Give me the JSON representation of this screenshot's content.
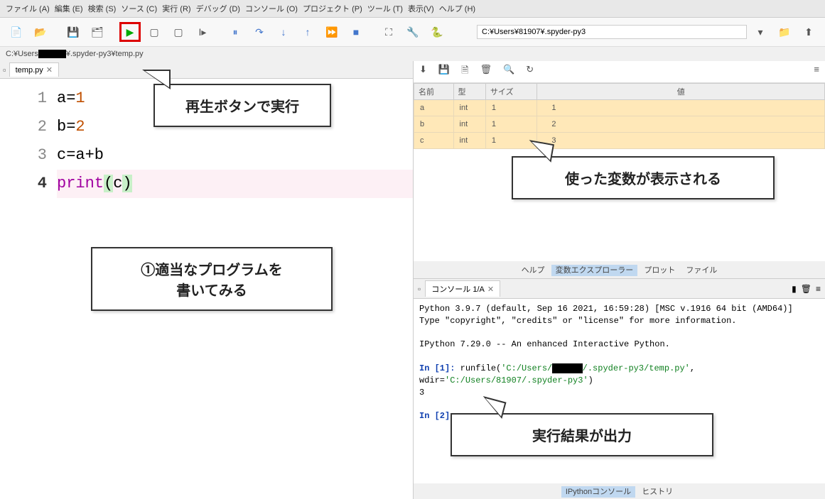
{
  "menubar": [
    "ファイル (A)",
    "編集 (E)",
    "検索 (S)",
    "ソース (C)",
    "実行 (R)",
    "デバッグ (D)",
    "コンソール (O)",
    "プロジェクト (P)",
    "ツール (T)",
    "表示(V)",
    "ヘルプ (H)"
  ],
  "path_value": "C:¥Users¥81907¥.spyder-py3",
  "breadcrumb_prefix": "C:¥Users",
  "breadcrumb_suffix": "¥.spyder-py3¥temp.py",
  "editor": {
    "tab_label": "temp.py",
    "lines": [
      {
        "n": "1",
        "plain": "a=",
        "num": "1"
      },
      {
        "n": "2",
        "plain": "b=",
        "num": "2"
      },
      {
        "n": "3",
        "plain": "c=a+b",
        "num": ""
      },
      {
        "n": "4",
        "func": "print",
        "open": "(",
        "arg": "c",
        "close": ")"
      }
    ]
  },
  "variables": {
    "headers": [
      "名前",
      "型",
      "サイズ",
      "値"
    ],
    "rows": [
      {
        "name": "a",
        "type": "int",
        "size": "1",
        "value": "1"
      },
      {
        "name": "b",
        "type": "int",
        "size": "1",
        "value": "2"
      },
      {
        "name": "c",
        "type": "int",
        "size": "1",
        "value": "3"
      }
    ]
  },
  "pane_tabs": [
    "ヘルプ",
    "変数エクスプローラー",
    "プロット",
    "ファイル"
  ],
  "console": {
    "tab_label": "コンソール 1/A",
    "banner1": "Python 3.9.7 (default, Sep 16 2021, 16:59:28) [MSC v.1916 64 bit (AMD64)]",
    "banner2": "Type \"copyright\", \"credits\" or \"license\" for more information.",
    "banner3": "IPython 7.29.0 -- An enhanced Interactive Python.",
    "in1_label": "In [1]:",
    "in1_cmd": " runfile(",
    "in1_path1": "'C:/Users/",
    "in1_path2": "/.spyder-py3/temp.py'",
    "in1_mid": ", wdir=",
    "in1_path3": "'C:/Users/81907/.spyder-py3'",
    "in1_end": ")",
    "output": "3",
    "in2_label": "In [2]:"
  },
  "console_bottom_tabs": [
    "IPythonコンソール",
    "ヒストリ"
  ],
  "callouts": {
    "c1": "再生ボタンで実行",
    "c2a": "①適当なプログラムを",
    "c2b": "書いてみる",
    "c3": "使った変数が表示される",
    "c4": "実行結果が出力"
  }
}
